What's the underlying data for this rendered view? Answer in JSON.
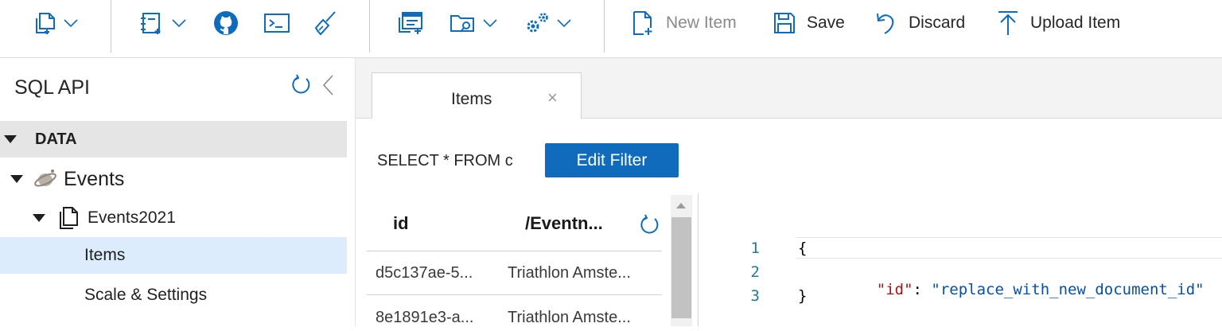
{
  "toolbar": {
    "new_item_label": "New Item",
    "save_label": "Save",
    "discard_label": "Discard",
    "upload_label": "Upload Item",
    "icons": [
      "new-container-icon",
      "new-notebook-icon",
      "github-icon",
      "terminal-icon",
      "clear-icon",
      "new-query-icon",
      "open-query-icon",
      "settings-icon",
      "new-item-icon",
      "save-icon",
      "discard-icon",
      "upload-icon"
    ]
  },
  "sidebar": {
    "title": "SQL API",
    "data_label": "DATA",
    "database": "Events",
    "container": "Events2021",
    "items_label": "Items",
    "settings_label": "Scale & Settings"
  },
  "tabs": [
    {
      "label": "Items",
      "close": "×"
    }
  ],
  "query": {
    "text": "SELECT * FROM c",
    "edit_filter_label": "Edit Filter"
  },
  "grid": {
    "headers": [
      "id",
      "/Eventn..."
    ],
    "rows": [
      [
        "d5c137ae-5...",
        "Triathlon Amste..."
      ],
      [
        "8e1891e3-a...",
        "Triathlon Amste..."
      ]
    ]
  },
  "editor": {
    "line_numbers": [
      "1",
      "2",
      "3"
    ],
    "open_brace": "{",
    "key": "\"id\"",
    "colon": ": ",
    "value": "\"replace_with_new_document_id\"",
    "close_brace": "}"
  },
  "colors": {
    "accent": "#0f6cbd",
    "selected_row": "#dcecfc",
    "json_key": "#a31515",
    "json_string": "#0451a5",
    "line_number": "#237893"
  }
}
